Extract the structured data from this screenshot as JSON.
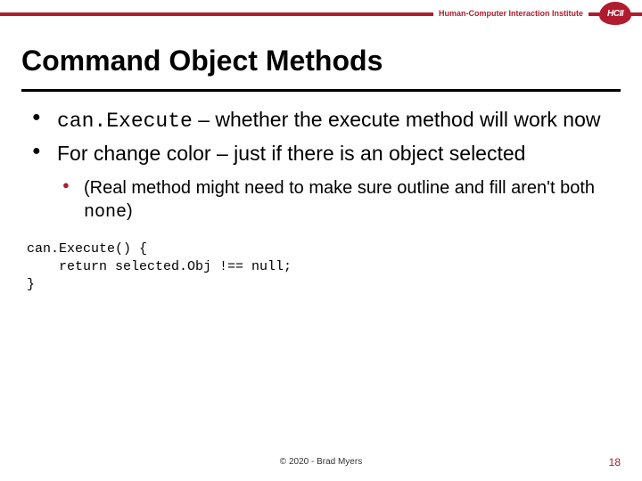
{
  "header": {
    "institute_label": "Human-Computer Interaction Institute",
    "logo_text": "HCII"
  },
  "title": "Command Object Methods",
  "bullets": [
    {
      "code": "can.Execute",
      "rest": " – whether the execute method will work now"
    },
    {
      "text": "For change color – just if there is an object selected",
      "sub": [
        {
          "pre": "(Real method might need to make sure outline and fill aren't both ",
          "code": "none",
          "post": ")"
        }
      ]
    }
  ],
  "code_block": "can.Execute() {\n    return selected.Obj !== null;\n}",
  "footer": {
    "copyright": "© 2020 - Brad Myers",
    "slide_number": "18"
  }
}
